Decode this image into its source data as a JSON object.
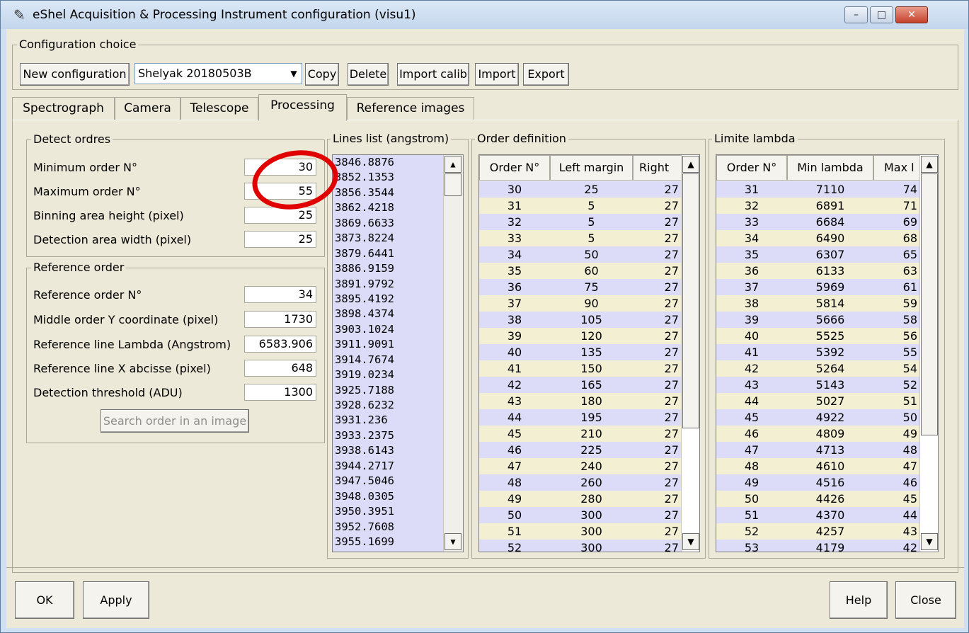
{
  "window": {
    "title": "eShel Acquisition & Processing Instrument configuration (visu1)",
    "minimize": "–",
    "maximize": "□",
    "close": "✕"
  },
  "config": {
    "legend": "Configuration choice",
    "new_btn": "New configuration",
    "selected": "Shelyak 20180503B",
    "copy_btn": "Copy",
    "delete_btn": "Delete",
    "import_calib_btn": "Import calib",
    "import_btn": "Import",
    "export_btn": "Export"
  },
  "tabs": [
    {
      "label": "Spectrograph"
    },
    {
      "label": "Camera"
    },
    {
      "label": "Telescope"
    },
    {
      "label": "Processing"
    },
    {
      "label": "Reference images"
    }
  ],
  "detect": {
    "legend": "Detect ordres",
    "fields": [
      {
        "label": "Minimum order N°",
        "value": "30"
      },
      {
        "label": "Maximum order N°",
        "value": "55"
      },
      {
        "label": "Binning area height (pixel)",
        "value": "25"
      },
      {
        "label": "Detection area width (pixel)",
        "value": "25"
      }
    ]
  },
  "reference": {
    "legend": "Reference order",
    "fields": [
      {
        "label": "Reference order N°",
        "value": "34"
      },
      {
        "label": "Middle order Y coordinate (pixel)",
        "value": "1730"
      },
      {
        "label": "Reference line Lambda (Angstrom)",
        "value": "6583.906"
      },
      {
        "label": "Reference line X abcisse (pixel)",
        "value": "648"
      },
      {
        "label": "Detection threshold (ADU)",
        "value": "1300"
      }
    ],
    "search_btn": "Search order in an image"
  },
  "lines": {
    "legend": "Lines list (angstrom)",
    "items": [
      "3846.8876",
      "3852.1353",
      "3856.3544",
      "3862.4218",
      "3869.6633",
      "3873.8224",
      "3879.6441",
      "3886.9159",
      "3891.9792",
      "3895.4192",
      "3898.4374",
      "3903.1024",
      "3911.9091",
      "3914.7674",
      "3919.0234",
      "3925.7188",
      "3928.6232",
      "3931.236",
      "3933.2375",
      "3938.6143",
      "3944.2717",
      "3947.5046",
      "3948.0305",
      "3950.3951",
      "3952.7608",
      "3955.1699"
    ]
  },
  "orderdef": {
    "legend": "Order definition",
    "headers": [
      "Order N°",
      "Left margin",
      "Right"
    ],
    "rows": [
      [
        "30",
        "25",
        "27"
      ],
      [
        "31",
        "5",
        "27"
      ],
      [
        "32",
        "5",
        "27"
      ],
      [
        "33",
        "5",
        "27"
      ],
      [
        "34",
        "50",
        "27"
      ],
      [
        "35",
        "60",
        "27"
      ],
      [
        "36",
        "75",
        "27"
      ],
      [
        "37",
        "90",
        "27"
      ],
      [
        "38",
        "105",
        "27"
      ],
      [
        "39",
        "120",
        "27"
      ],
      [
        "40",
        "135",
        "27"
      ],
      [
        "41",
        "150",
        "27"
      ],
      [
        "42",
        "165",
        "27"
      ],
      [
        "43",
        "180",
        "27"
      ],
      [
        "44",
        "195",
        "27"
      ],
      [
        "45",
        "210",
        "27"
      ],
      [
        "46",
        "225",
        "27"
      ],
      [
        "47",
        "240",
        "27"
      ],
      [
        "48",
        "260",
        "27"
      ],
      [
        "49",
        "280",
        "27"
      ],
      [
        "50",
        "300",
        "27"
      ],
      [
        "51",
        "300",
        "27"
      ],
      [
        "52",
        "300",
        "27"
      ]
    ]
  },
  "limite": {
    "legend": "Limite lambda",
    "headers": [
      "Order N°",
      "Min lambda",
      "Max l"
    ],
    "rows": [
      [
        "31",
        "7110",
        "74"
      ],
      [
        "32",
        "6891",
        "71"
      ],
      [
        "33",
        "6684",
        "69"
      ],
      [
        "34",
        "6490",
        "68"
      ],
      [
        "35",
        "6307",
        "65"
      ],
      [
        "36",
        "6133",
        "63"
      ],
      [
        "37",
        "5969",
        "61"
      ],
      [
        "38",
        "5814",
        "59"
      ],
      [
        "39",
        "5666",
        "58"
      ],
      [
        "40",
        "5525",
        "56"
      ],
      [
        "41",
        "5392",
        "55"
      ],
      [
        "42",
        "5264",
        "54"
      ],
      [
        "43",
        "5143",
        "52"
      ],
      [
        "44",
        "5027",
        "51"
      ],
      [
        "45",
        "4922",
        "50"
      ],
      [
        "46",
        "4809",
        "49"
      ],
      [
        "47",
        "4713",
        "48"
      ],
      [
        "48",
        "4610",
        "47"
      ],
      [
        "49",
        "4516",
        "46"
      ],
      [
        "50",
        "4426",
        "45"
      ],
      [
        "51",
        "4370",
        "44"
      ],
      [
        "52",
        "4257",
        "43"
      ],
      [
        "53",
        "4179",
        "42"
      ]
    ]
  },
  "footer": {
    "ok": "OK",
    "apply": "Apply",
    "help": "Help",
    "close": "Close"
  }
}
